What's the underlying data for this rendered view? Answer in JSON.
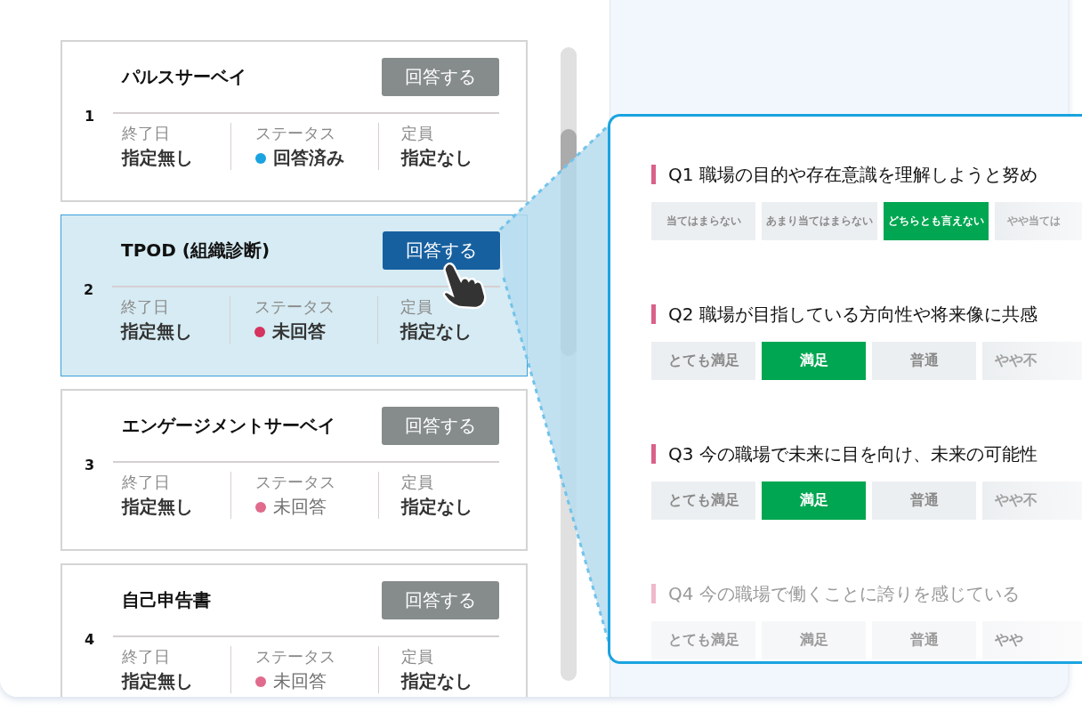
{
  "surveys": [
    {
      "number": "1",
      "title": "パルスサーベイ",
      "button": "回答する",
      "selected": false,
      "fields": [
        {
          "label": "終了日",
          "value": "指定無し",
          "muted": false
        },
        {
          "label": "ステータス",
          "value": "回答済み",
          "color": "#1aa3e0",
          "muted": false
        },
        {
          "label": "定員",
          "value": "指定なし",
          "muted": false
        }
      ]
    },
    {
      "number": "2",
      "title": "TPOD (組織診断)",
      "button": "回答する",
      "selected": true,
      "fields": [
        {
          "label": "終了日",
          "value": "指定無し",
          "muted": false
        },
        {
          "label": "ステータス",
          "value": "未回答",
          "color": "#d6335e",
          "muted": false
        },
        {
          "label": "定員",
          "value": "指定なし",
          "muted": false
        }
      ]
    },
    {
      "number": "3",
      "title": "エンゲージメントサーベイ",
      "button": "回答する",
      "selected": false,
      "fields": [
        {
          "label": "終了日",
          "value": "指定無し",
          "muted": false
        },
        {
          "label": "ステータス",
          "value": "未回答",
          "color": "#e06b8d",
          "muted": true
        },
        {
          "label": "定員",
          "value": "指定なし",
          "muted": false
        }
      ]
    },
    {
      "number": "4",
      "title": "自己申告書",
      "button": "回答する",
      "selected": false,
      "fields": [
        {
          "label": "終了日",
          "value": "指定無し",
          "muted": false
        },
        {
          "label": "ステータス",
          "value": "未回答",
          "color": "#e06b8d",
          "muted": true
        },
        {
          "label": "定員",
          "value": "指定なし",
          "muted": false
        }
      ]
    }
  ],
  "detail": {
    "questions": [
      {
        "text": "Q1 職場の目的や存在意識を理解しようと努め",
        "faded": false,
        "kind": "agreement",
        "options": [
          {
            "label": "当てはまらない",
            "selected": false
          },
          {
            "label": "あまり当てはまらない",
            "selected": false
          },
          {
            "label": "どちらとも言えない",
            "selected": true
          },
          {
            "label": "やや当ては",
            "selected": false
          }
        ]
      },
      {
        "text": "Q2 職場が目指している方向性や将来像に共感",
        "faded": false,
        "kind": "satisfaction",
        "options": [
          {
            "label": "とても満足",
            "selected": false
          },
          {
            "label": "満足",
            "selected": true
          },
          {
            "label": "普通",
            "selected": false
          },
          {
            "label": "やや不",
            "selected": false
          }
        ]
      },
      {
        "text": "Q3 今の職場で未来に目を向け、未来の可能性",
        "faded": false,
        "kind": "satisfaction",
        "options": [
          {
            "label": "とても満足",
            "selected": false
          },
          {
            "label": "満足",
            "selected": true
          },
          {
            "label": "普通",
            "selected": false
          },
          {
            "label": "やや不",
            "selected": false
          }
        ]
      },
      {
        "text": "Q4 今の職場で働くことに誇りを感じている",
        "faded": true,
        "kind": "satisfaction",
        "options": [
          {
            "label": "とても満足",
            "selected": false
          },
          {
            "label": "満足",
            "selected": false
          },
          {
            "label": "普通",
            "selected": false
          },
          {
            "label": "やや",
            "selected": false
          }
        ]
      }
    ]
  }
}
